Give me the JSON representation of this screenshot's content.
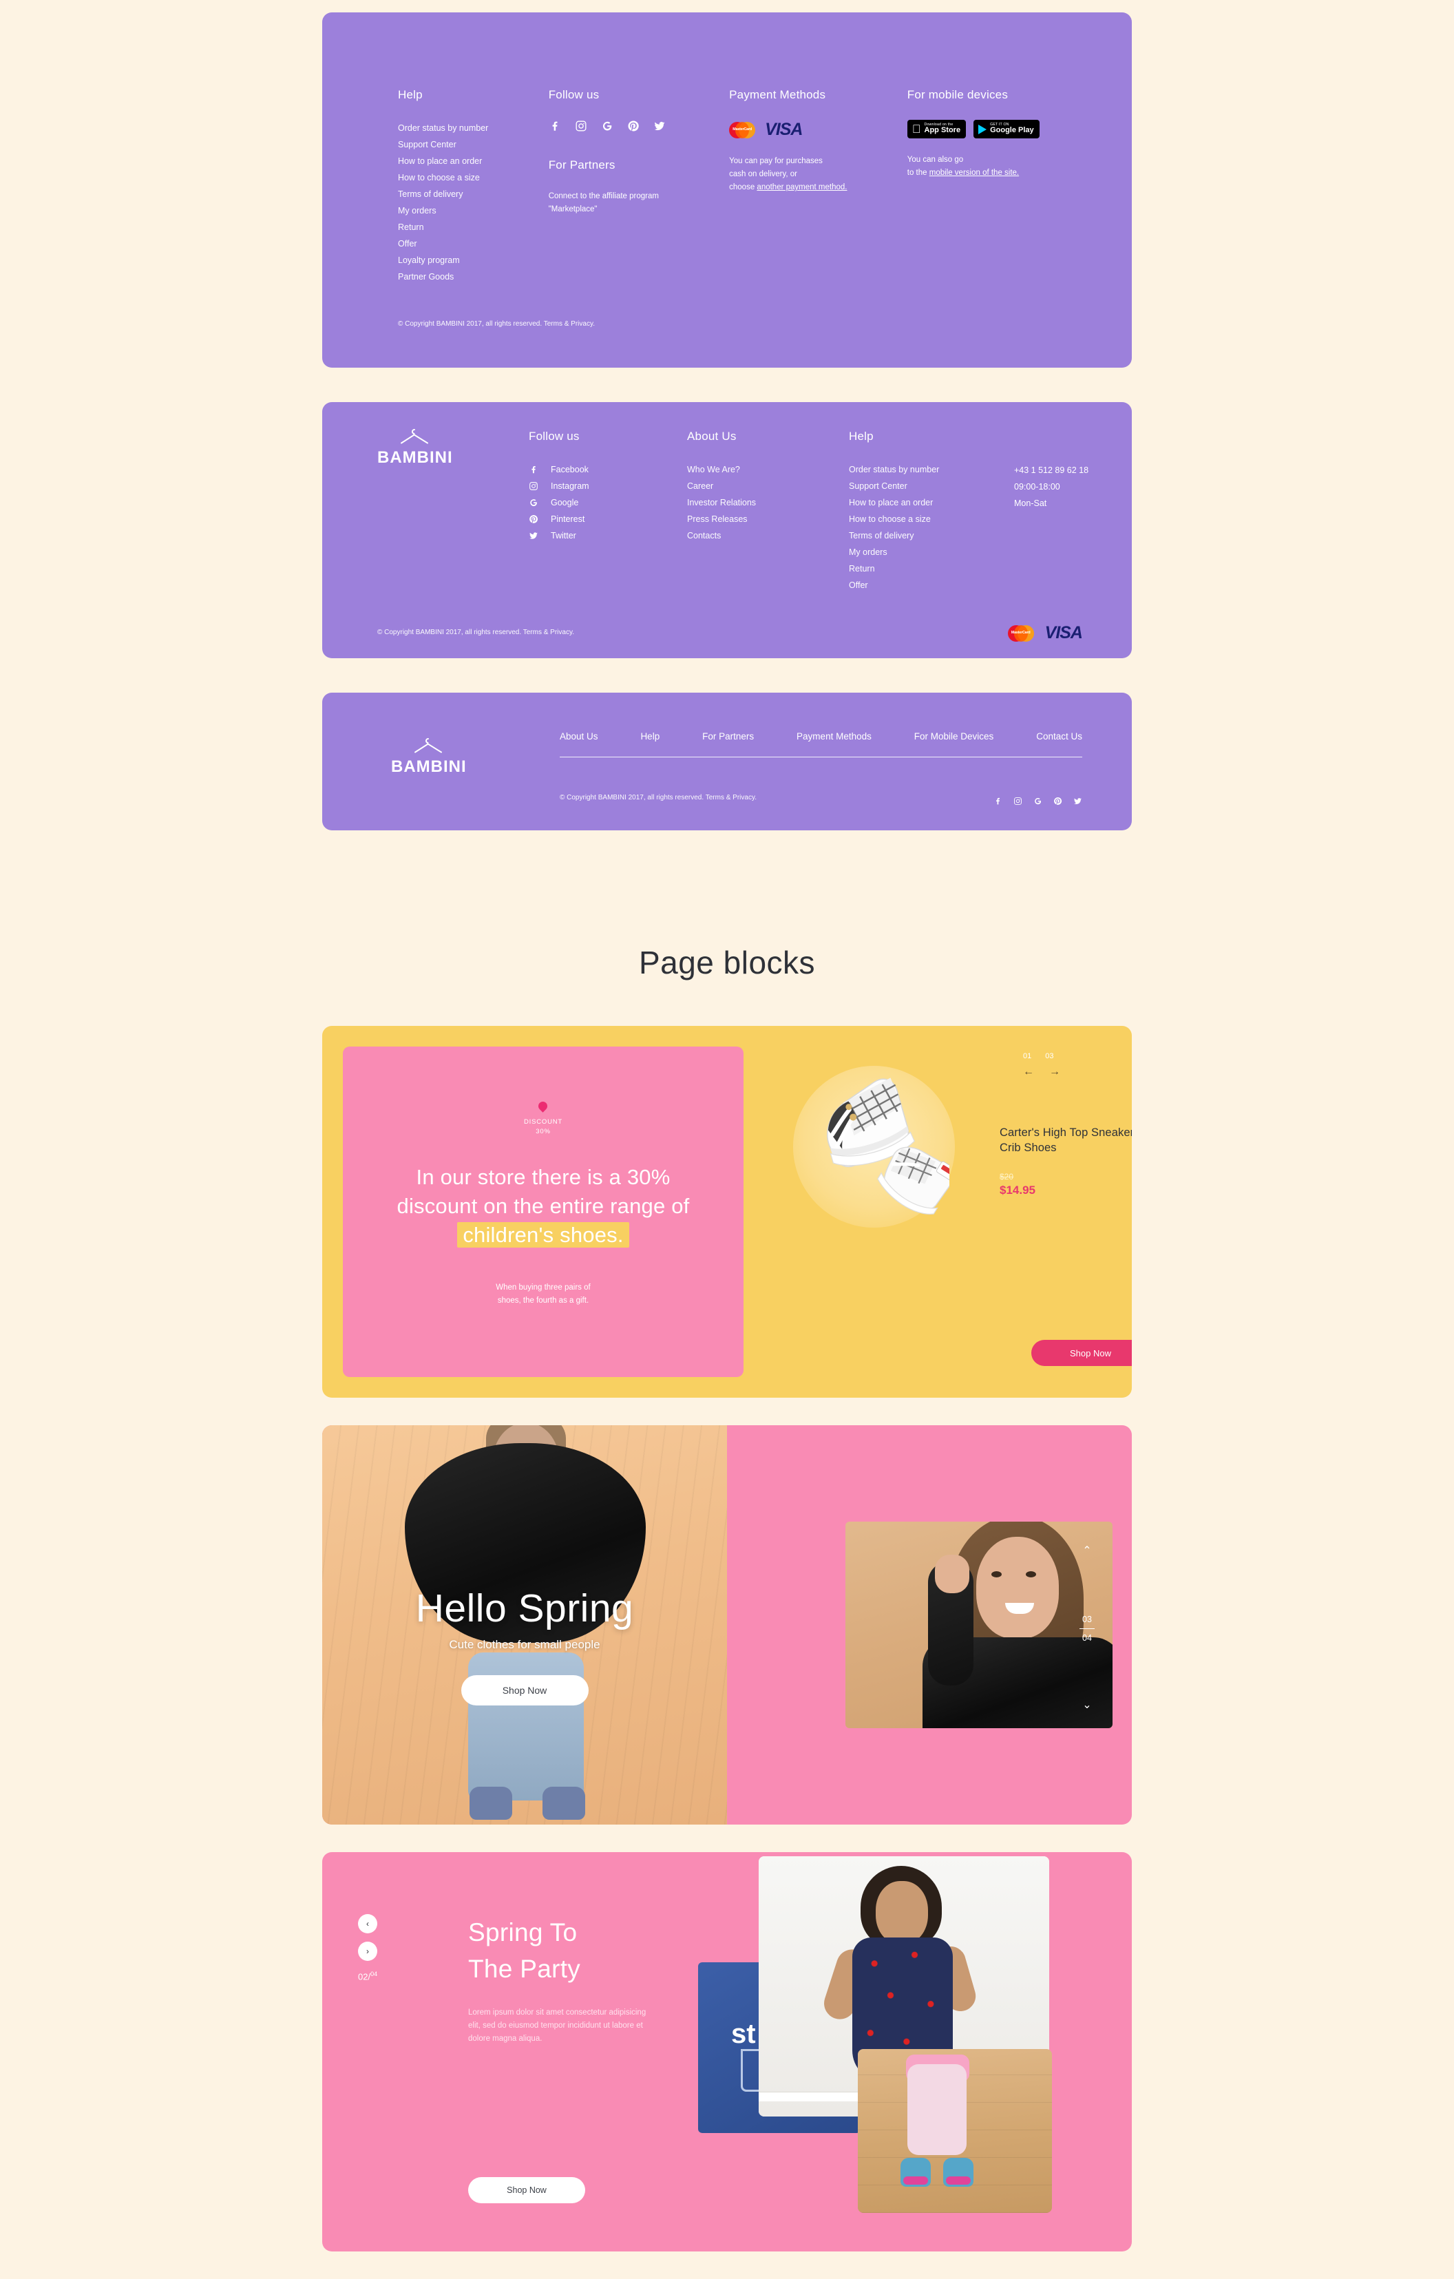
{
  "brand": {
    "name": "BAMBINI",
    "purple": "#9c80db",
    "pink": "#f98bb4",
    "yellow": "#f8d061",
    "accent_pink": "#e8386d",
    "bg": "#fdf3e3"
  },
  "footer1": {
    "help": {
      "title": "Help",
      "links": [
        "Order status by number",
        "Support Center",
        "How to place an order",
        "How to choose a size",
        "Terms of delivery",
        "My orders",
        "Return",
        "Offer",
        "Loyalty program",
        "Partner Goods"
      ]
    },
    "follow": {
      "title": "Follow us",
      "socials": [
        "facebook-icon",
        "instagram-icon",
        "google-icon",
        "pinterest-icon",
        "twitter-icon"
      ],
      "partners_title": "For Partners",
      "partners_text": "Connect to the affiliate program \"Marketplace\""
    },
    "payment": {
      "title": "Payment Methods",
      "cards": [
        "MasterCard",
        "VISA"
      ],
      "line1": "You can pay for purchases",
      "line2": "cash on delivery, or",
      "line3_prefix": "choose ",
      "line3_link": "another payment method."
    },
    "mobile": {
      "title": "For mobile devices",
      "appstore_top": "Download on the",
      "appstore_bottom": "App Store",
      "play_top": "GET IT ON",
      "play_bottom": "Google Play",
      "line1": "You can also go",
      "line2_prefix": "to the ",
      "line2_link": "mobile version of the site."
    },
    "copyright": "© Copyright BAMBINI 2017, all rights reserved. Terms & Privacy."
  },
  "footer2": {
    "follow": {
      "title": "Follow us",
      "items": [
        {
          "icon": "facebook-icon",
          "label": "Facebook"
        },
        {
          "icon": "instagram-icon",
          "label": "Instagram"
        },
        {
          "icon": "google-icon",
          "label": "Google"
        },
        {
          "icon": "pinterest-icon",
          "label": "Pinterest"
        },
        {
          "icon": "twitter-icon",
          "label": "Twitter"
        }
      ]
    },
    "about": {
      "title": "About Us",
      "links": [
        "Who We Are?",
        "Career",
        "Investor Relations",
        "Press Releases",
        "Contacts"
      ]
    },
    "help": {
      "title": "Help",
      "links": [
        "Order status by number",
        "Support Center",
        "How to place an order",
        "How to choose a size",
        "Terms of delivery",
        "My orders",
        "Return",
        "Offer"
      ]
    },
    "contact": {
      "phone": "+43 1 512 89 62 18",
      "hours": "09:00-18:00",
      "days": "Mon-Sat"
    },
    "copyright": "© Copyright BAMBINI 2017, all rights reserved. Terms & Privacy.",
    "cards": [
      "MasterCard",
      "VISA"
    ]
  },
  "footer3": {
    "nav": [
      "About Us",
      "Help",
      "For Partners",
      "Payment Methods",
      "For Mobile Devices",
      "Contact Us"
    ],
    "copyright": "© Copyright BAMBINI 2017, all rights reserved. Terms & Privacy.",
    "socials": [
      "facebook-icon",
      "instagram-icon",
      "google-icon",
      "pinterest-icon",
      "twitter-icon"
    ]
  },
  "section": {
    "title": "Page blocks"
  },
  "blockA": {
    "badge_line1": "DISCOUNT",
    "badge_line2": "30%",
    "headline_part1": "In our store there is a 30% discount on the entire range of ",
    "headline_highlight": "children's shoes.",
    "sub_line1": "When buying three pairs of",
    "sub_line2": "shoes, the fourth as a gift.",
    "slider_current": "01",
    "slider_total": "03",
    "arrow_prev": "←",
    "arrow_next": "→",
    "product_title": "Carter's High Top Sneaker Crib Shoes",
    "price_old": "$20",
    "price_new": "$14.95",
    "cta": "Shop Now"
  },
  "blockB": {
    "title": "Hello Spring",
    "subtitle": "Cute clothes for small people",
    "cta": "Shop Now",
    "slider_current": "03",
    "slider_total": "04",
    "chevron_up": "⌃",
    "chevron_down": "⌄"
  },
  "blockC": {
    "title_line1": "Spring To",
    "title_line2": "The Party",
    "paragraph": "Lorem ipsum dolor sit amet consectetur adipisicing elit, sed do eiusmod tempor incididunt ut labore et dolore magna aliqua.",
    "cta": "Shop Now",
    "slider_current": "02",
    "slider_total": "04",
    "arrow_prev": "‹",
    "arrow_next": "›",
    "collage_text": "st"
  }
}
